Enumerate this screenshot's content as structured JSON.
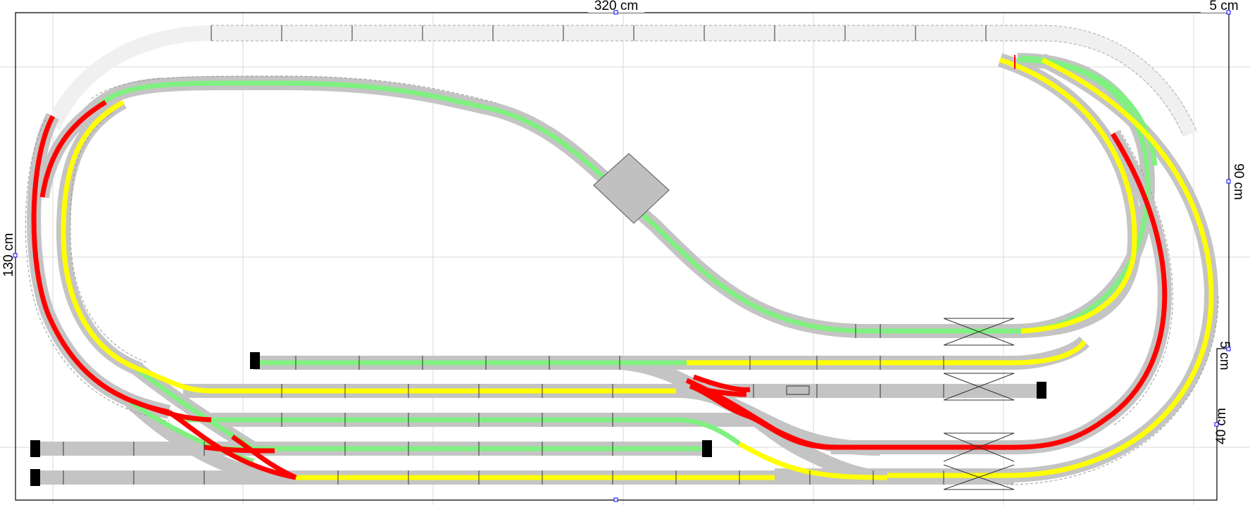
{
  "dimensions": {
    "width_label": "320 cm",
    "height_label": "130 cm",
    "top_right_offset": "5 cm",
    "right_upper": "90 cm",
    "right_gap": "5 cm",
    "right_lower": "40 cm"
  },
  "tracks": {
    "main_color": "#ff0000",
    "loop_color": "#ffff00",
    "branch_color": "#80f080",
    "sleeper_color": "#c0c0c0",
    "plain_color": "#f0f0f0"
  },
  "decorations": {
    "bridge": "bridge-platform",
    "bumpers": "buffer-stop-icon",
    "crossing": "crossing-marker-icon"
  }
}
